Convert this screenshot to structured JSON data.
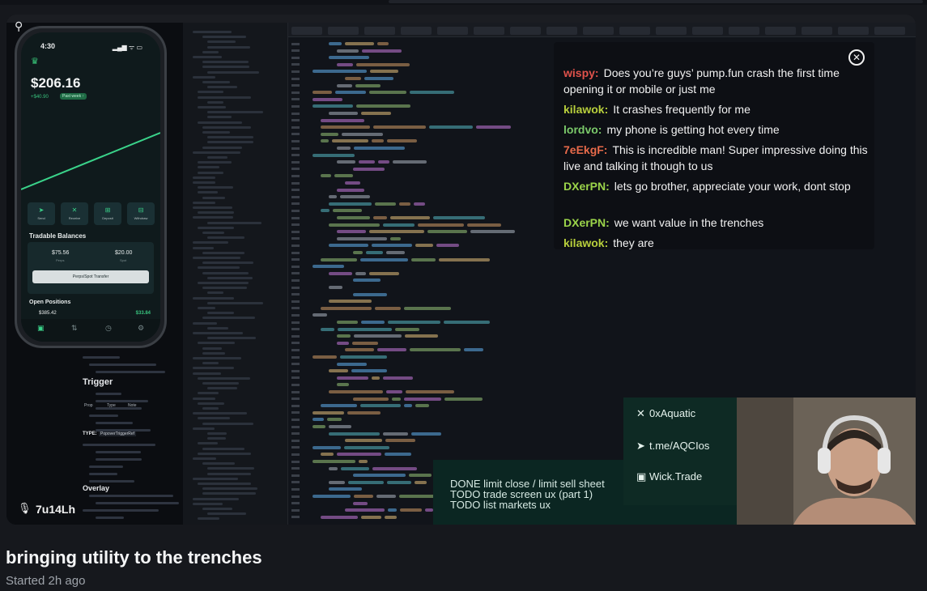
{
  "stream": {
    "title": "bringing utility to the trenches",
    "started": "Started 2h ago",
    "streamer": "7u14Lh"
  },
  "phone": {
    "time": "4:30",
    "status": "▂▄▆ ᯤ ▭",
    "balance": "$206.16",
    "change": "+$40.90",
    "change_badge": "Past week ↑",
    "actions": [
      {
        "label": "Send",
        "icon": "send-icon"
      },
      {
        "label": "Receive",
        "icon": "receive-icon"
      },
      {
        "label": "Deposit",
        "icon": "deposit-icon"
      },
      {
        "label": "Withdraw",
        "icon": "withdraw-icon"
      }
    ],
    "tradable_title": "Tradable Balances",
    "perps_value": "$75.56",
    "perps_label": "Perps",
    "spot_value": "$20.00",
    "spot_label": "Spot",
    "transfer_label": "Perps/Spot Transfer",
    "open_positions_title": "Open Positions",
    "position_value": "$385.42",
    "position_pnl": "$33.84",
    "accent": "#3ad38a"
  },
  "doc_panel": {
    "trigger_heading": "Trigger",
    "type_heading": "TYPE:",
    "type_code": "PopoverTriggerRef",
    "overlay_heading": "Overlay",
    "prop_col": "Prop",
    "type_col": "Type",
    "note_col": "Note"
  },
  "chat": {
    "messages": [
      {
        "user": "wispy:",
        "color": "#e0524b",
        "text": "Does you’re guys’ pump.fun crash the first time opening it or mobile or just me"
      },
      {
        "user": "kilawok:",
        "color": "#b8cf3c",
        "text": "It crashes frequently for me"
      },
      {
        "user": "lordvo:",
        "color": "#7bc96a",
        "text": "my phone is getting hot every time"
      },
      {
        "user": "7eEkgF:",
        "color": "#e86a4a",
        "text": "This is incredible man! Super impressive doing this live and talking it though to us"
      },
      {
        "user": "DXerPN:",
        "color": "#9bd44a",
        "text": "lets go brother, appreciate your work, dont stop"
      },
      {
        "user": "DXerPN:",
        "color": "#9bd44a",
        "text": "we want value in the trenches"
      },
      {
        "user": "kilawok:",
        "color": "#b8cf3c",
        "text": "they are"
      }
    ]
  },
  "links": [
    {
      "icon": "x-icon",
      "glyph": "✕",
      "text": "0xAquatic"
    },
    {
      "icon": "telegram-icon",
      "glyph": "➤",
      "text": "t.me/AQCIos"
    },
    {
      "icon": "wallet-icon",
      "glyph": "▣",
      "text": "Wick.Trade"
    }
  ],
  "todo": [
    "DONE limit close / limit sell sheet",
    "TODO trade screen ux (part 1)",
    "TODO list markets ux"
  ]
}
